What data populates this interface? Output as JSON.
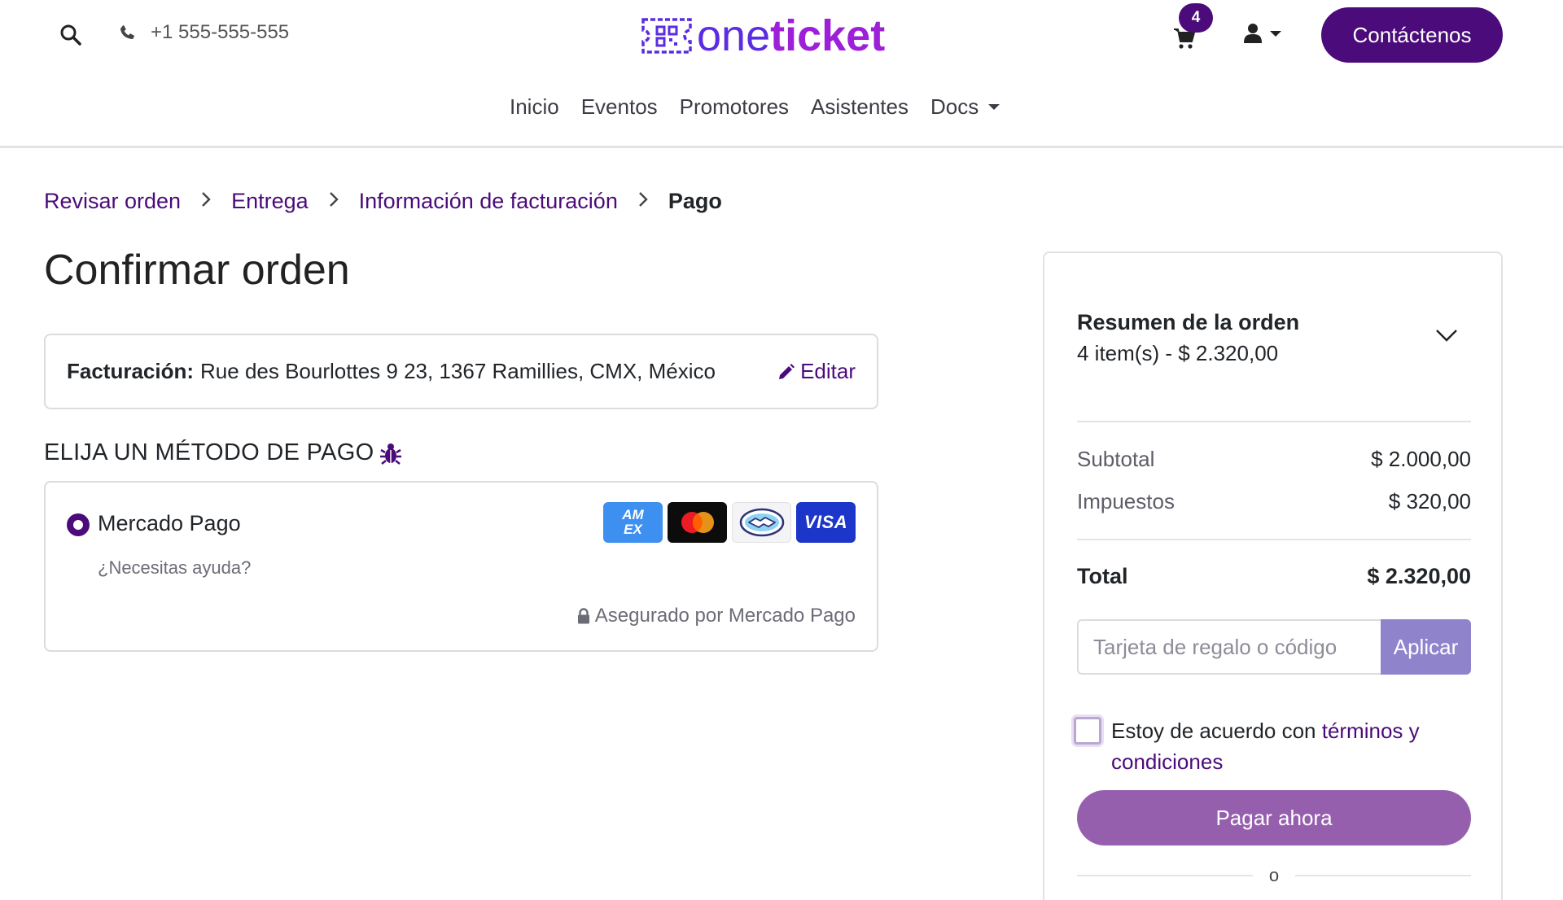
{
  "header": {
    "phone": "+1 555-555-555",
    "logo": {
      "part1": "one",
      "part2": "ticket"
    },
    "cart_count": "4",
    "contact_label": "Contáctenos",
    "colors": {
      "brand": "#4b0b7a",
      "logo_one": "#5b2ce0",
      "logo_ticket": "#9d1fd8"
    }
  },
  "nav": {
    "items": [
      "Inicio",
      "Eventos",
      "Promotores",
      "Asistentes"
    ],
    "docs": "Docs"
  },
  "breadcrumb": [
    "Revisar orden",
    "Entrega",
    "Información de facturación",
    "Pago"
  ],
  "page_title": "Confirmar orden",
  "billing": {
    "label": "Facturación:",
    "address": "Rue des Bourlottes 9 23, 1367 Ramillies, CMX, México",
    "edit_label": "Editar"
  },
  "payment": {
    "heading": "ELIJA UN MÉTODO DE PAGO",
    "method_name": "Mercado Pago",
    "help_text": "¿Necesitas ayuda?",
    "secured_text": "Asegurado por Mercado Pago",
    "card_icons": [
      "amex-icon",
      "mastercard-icon",
      "mercadopago-icon",
      "visa-icon"
    ],
    "amex_text": "AM EX",
    "visa_text": "VISA"
  },
  "summary": {
    "title": "Resumen de la orden",
    "items_text": "4 item(s) -  $ 2.320,00",
    "subtotal_label": "Subtotal",
    "subtotal_value": "$ 2.000,00",
    "taxes_label": "Impuestos",
    "taxes_value": "$ 320,00",
    "total_label": "Total",
    "total_value": "$ 2.320,00",
    "gift_placeholder": "Tarjeta de regalo o código",
    "apply_label": "Aplicar",
    "terms_prefix": "Estoy de acuerdo con ",
    "terms_link": "términos y condiciones",
    "pay_label": "Pagar ahora",
    "or_text": "o"
  }
}
